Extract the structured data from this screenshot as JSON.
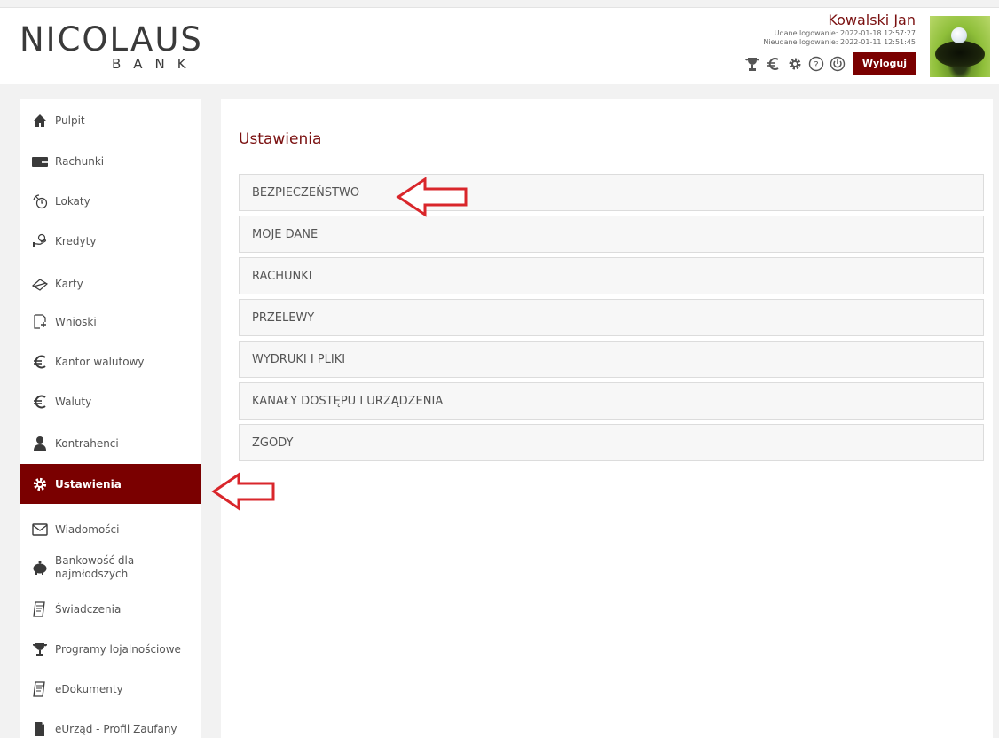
{
  "brand": {
    "name": "NICOLAUS",
    "sub": "BANK"
  },
  "user": {
    "name": "Kowalski Jan",
    "success_login": "Udane logowanie: 2022-01-18 12:57:27",
    "failed_login": "Nieudane logowanie: 2022-01-11 12:51:45"
  },
  "header_icons": [
    "trophy-icon",
    "euro-icon",
    "gear-icon",
    "help-icon",
    "power-icon"
  ],
  "logout_label": "Wyloguj",
  "sidebar": {
    "items": [
      {
        "label": "Pulpit",
        "icon": "home-icon"
      },
      {
        "label": "Rachunki",
        "icon": "wallet-icon"
      },
      {
        "label": "Lokaty",
        "icon": "deposit-icon"
      },
      {
        "label": "Kredyty",
        "icon": "loan-icon"
      },
      {
        "label": "Karty",
        "icon": "card-icon"
      },
      {
        "label": "Wnioski",
        "icon": "document-icon"
      },
      {
        "label": "Kantor walutowy",
        "icon": "euro-icon"
      },
      {
        "label": "Waluty",
        "icon": "euro-icon"
      },
      {
        "label": "Kontrahenci",
        "icon": "contacts-icon"
      },
      {
        "label": "Ustawienia",
        "icon": "gear-icon",
        "active": true
      },
      {
        "label": "Wiadomości",
        "icon": "envelope-icon"
      },
      {
        "label": "Bankowość dla najmłodszych",
        "line1": "Bankowość dla",
        "line2": "najmłodszych",
        "icon": "piggy-bank-icon"
      },
      {
        "label": "Świadczenia",
        "icon": "benefits-icon"
      },
      {
        "label": "Programy lojalnościowe",
        "icon": "trophy-icon"
      },
      {
        "label": "eDokumenty",
        "icon": "edocuments-icon"
      },
      {
        "label": "eUrząd - Profil Zaufany",
        "icon": "trusted-profile-icon"
      }
    ]
  },
  "main": {
    "title": "Ustawienia",
    "items": [
      "BEZPIECZEŃSTWO",
      "MOJE DANE",
      "RACHUNKI",
      "PRZELEWY",
      "WYDRUKI I PLIKI",
      "KANAŁY DOSTĘPU I URZĄDZENIA",
      "ZGODY"
    ]
  },
  "colors": {
    "accent": "#7a0000",
    "title": "#7a1010",
    "arrow": "#d9262b"
  }
}
